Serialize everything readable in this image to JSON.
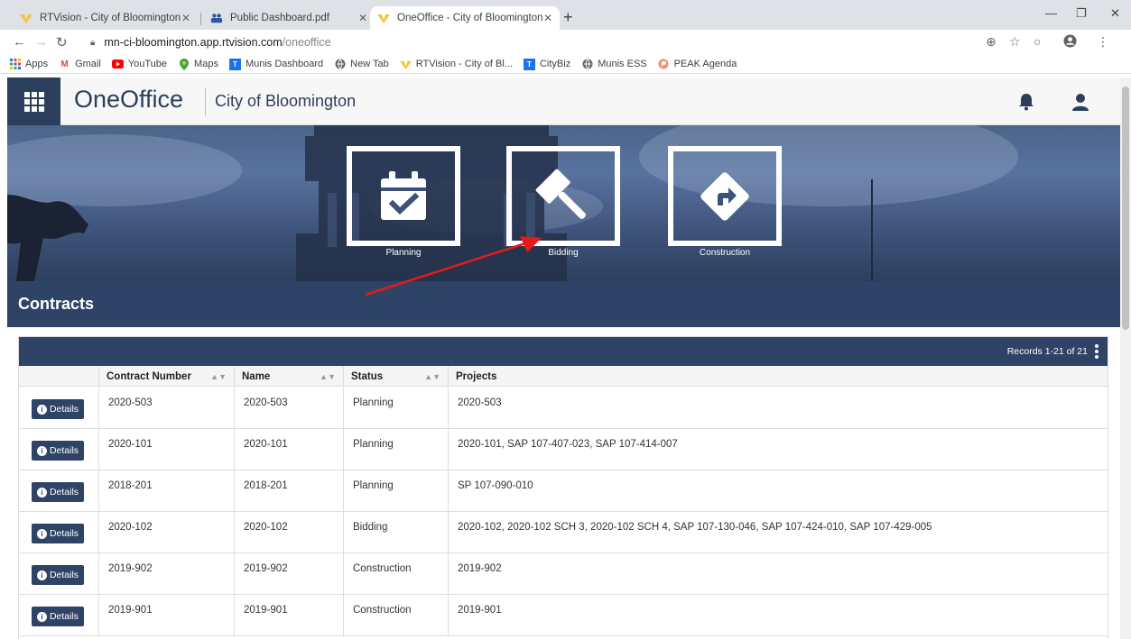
{
  "browser": {
    "tabs": [
      {
        "title": "RTVision - City of Bloomington",
        "active": false
      },
      {
        "title": "Public Dashboard.pdf",
        "active": false
      },
      {
        "title": "OneOffice - City of Bloomington",
        "active": true
      }
    ],
    "url_host": "mn-ci-bloomington.app.rtvision.com",
    "url_path": "/oneoffice",
    "bookmarks": [
      {
        "label": "Apps",
        "icon": "apps-grid-icon"
      },
      {
        "label": "Gmail",
        "icon": "gmail-icon"
      },
      {
        "label": "YouTube",
        "icon": "youtube-icon"
      },
      {
        "label": "Maps",
        "icon": "maps-pin-icon"
      },
      {
        "label": "Munis Dashboard",
        "icon": "munis-icon"
      },
      {
        "label": "New Tab",
        "icon": "globe-icon"
      },
      {
        "label": "RTVision - City of Bl...",
        "icon": "rtvision-icon"
      },
      {
        "label": "CityBiz",
        "icon": "munis-icon"
      },
      {
        "label": "Munis ESS",
        "icon": "globe-icon"
      },
      {
        "label": "PEAK Agenda",
        "icon": "peak-icon"
      }
    ]
  },
  "header": {
    "brand": "OneOffice",
    "org": "City of Bloomington"
  },
  "hero": {
    "tiles": [
      {
        "label": "Planning",
        "icon": "calendar-check-icon"
      },
      {
        "label": "Bidding",
        "icon": "gavel-icon"
      },
      {
        "label": "Construction",
        "icon": "turn-right-sign-icon"
      }
    ]
  },
  "section": {
    "title": "Contracts"
  },
  "table": {
    "records": "Records 1-21 of 21",
    "columns": [
      "Contract Number",
      "Name",
      "Status",
      "Projects"
    ],
    "details_label": "Details",
    "rows": [
      {
        "number": "2020-503",
        "name": "2020-503",
        "status": "Planning",
        "projects": "2020-503"
      },
      {
        "number": "2020-101",
        "name": "2020-101",
        "status": "Planning",
        "projects": "2020-101, SAP 107-407-023, SAP 107-414-007"
      },
      {
        "number": "2018-201",
        "name": "2018-201",
        "status": "Planning",
        "projects": "SP 107-090-010"
      },
      {
        "number": "2020-102",
        "name": "2020-102",
        "status": "Bidding",
        "projects": "2020-102, 2020-102 SCH 3, 2020-102 SCH 4, SAP 107-130-046, SAP 107-424-010, SAP 107-429-005"
      },
      {
        "number": "2019-902",
        "name": "2019-902",
        "status": "Construction",
        "projects": "2019-902"
      },
      {
        "number": "2019-901",
        "name": "2019-901",
        "status": "Construction",
        "projects": "2019-901"
      }
    ]
  },
  "colors": {
    "navy": "#2f4366",
    "annotation_arrow": "#e31b1b"
  }
}
